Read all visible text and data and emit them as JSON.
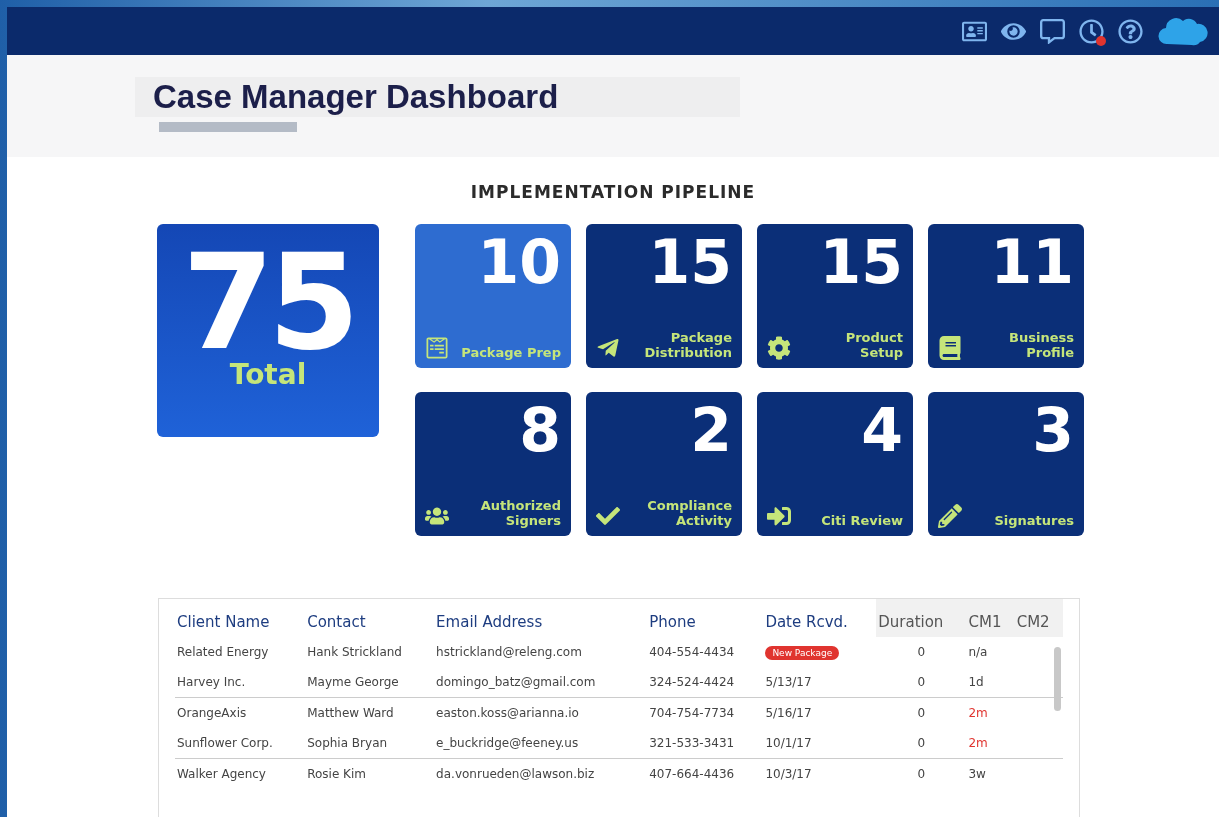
{
  "header": {
    "alarm_badge": true
  },
  "title": "Case Manager Dashboard",
  "pipeline": {
    "heading": "IMPLEMENTATION PIPELINE",
    "total": {
      "value": "75",
      "label": "Total"
    },
    "tiles": [
      {
        "value": "10",
        "label": "Package Prep",
        "selected": true
      },
      {
        "value": "15",
        "label": "Package Distribution",
        "selected": false
      },
      {
        "value": "15",
        "label": "Product Setup",
        "selected": false
      },
      {
        "value": "11",
        "label": "Business Profile",
        "selected": false
      },
      {
        "value": "8",
        "label": "Authorized Signers",
        "selected": false
      },
      {
        "value": "2",
        "label": "Compliance Activity",
        "selected": false
      },
      {
        "value": "4",
        "label": "Citi Review",
        "selected": false
      },
      {
        "value": "3",
        "label": "Signatures",
        "selected": false
      }
    ]
  },
  "table": {
    "columns": [
      "Client Name",
      "Contact",
      "Email Address",
      "Phone",
      "Date Rcvd.",
      "Duration",
      "CM1",
      "CM2"
    ],
    "rows": [
      {
        "client": "Related Energy",
        "contact": "Hank Strickland",
        "email": "hstrickland@releng.com",
        "phone": "404-554-4434",
        "date": {
          "kind": "badge",
          "text": "New Package"
        },
        "duration": "0",
        "cm1": {
          "text": "n/a",
          "overdue": false
        }
      },
      {
        "client": "Harvey Inc.",
        "contact": "Mayme George",
        "email": "domingo_batz@gmail.com",
        "phone": "324-524-4424",
        "date": {
          "kind": "text",
          "text": "5/13/17"
        },
        "duration": "0",
        "cm1": {
          "text": "1d",
          "overdue": false
        }
      },
      {
        "client": "OrangeAxis",
        "contact": "Matthew Ward",
        "email": "easton.koss@arianna.io",
        "phone": "704-754-7734",
        "date": {
          "kind": "text",
          "text": "5/16/17"
        },
        "duration": "0",
        "cm1": {
          "text": "2m",
          "overdue": true
        }
      },
      {
        "client": "Sunflower Corp.",
        "contact": "Sophia Bryan",
        "email": "e_buckridge@feeney.us",
        "phone": "321-533-3431",
        "date": {
          "kind": "text",
          "text": "10/1/17"
        },
        "duration": "0",
        "cm1": {
          "text": "2m",
          "overdue": true
        }
      },
      {
        "client": "Walker Agency",
        "contact": "Rosie Kim",
        "email": "da.vonrueden@lawson.biz",
        "phone": "407-664-4436",
        "date": {
          "kind": "text",
          "text": "10/3/17"
        },
        "duration": "0",
        "cm1": {
          "text": "3w",
          "overdue": false
        }
      }
    ]
  }
}
